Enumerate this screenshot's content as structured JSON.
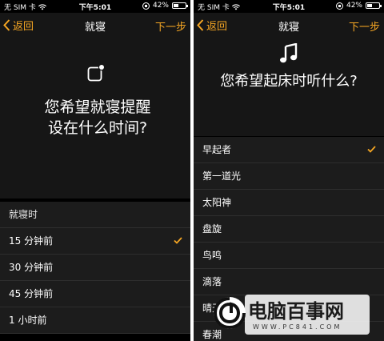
{
  "status_bar": {
    "carrier": "无 SIM 卡",
    "time": "下午5:01",
    "battery": "42%",
    "battery_level": 0.42
  },
  "left_screen": {
    "nav": {
      "back_label": "返回",
      "title": "就寝",
      "next_label": "下一步"
    },
    "hero": {
      "line1": "您希望就寝提醒",
      "line2": "设在什么时间?"
    },
    "list_header": "就寝时",
    "options": [
      {
        "label": "15 分钟前",
        "selected": true
      },
      {
        "label": "30 分钟前",
        "selected": false
      },
      {
        "label": "45 分钟前",
        "selected": false
      },
      {
        "label": "1 小时前",
        "selected": false
      }
    ]
  },
  "right_screen": {
    "nav": {
      "back_label": "返回",
      "title": "就寝",
      "next_label": "下一步"
    },
    "hero": {
      "line1": "您希望起床时听什么?"
    },
    "options": [
      {
        "label": "早起者",
        "selected": true
      },
      {
        "label": "第一道光",
        "selected": false
      },
      {
        "label": "太阳神",
        "selected": false
      },
      {
        "label": "盘旋",
        "selected": false
      },
      {
        "label": "鸟鸣",
        "selected": false
      },
      {
        "label": "滴落",
        "selected": false
      },
      {
        "label": "晴天",
        "selected": false
      },
      {
        "label": "春潮",
        "selected": false
      }
    ]
  },
  "watermark": {
    "brand": "电脑百事网",
    "url": "WWW.PC841.COM"
  },
  "colors": {
    "accent": "#f5a623",
    "background": "#000000",
    "panel": "#161616",
    "row": "#1c1c1c"
  }
}
